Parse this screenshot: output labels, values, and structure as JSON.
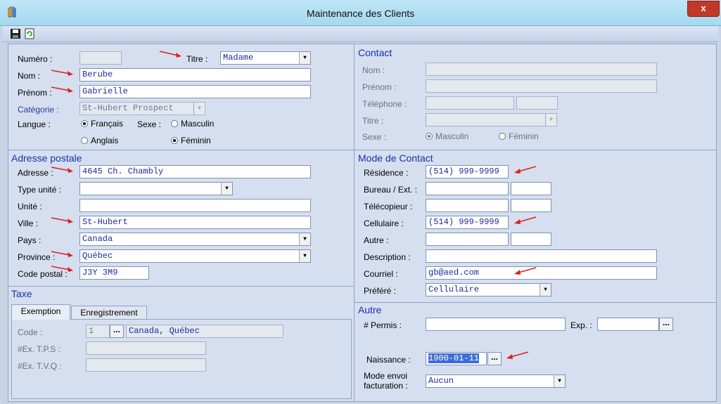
{
  "window": {
    "title": "Maintenance des Clients",
    "close_label": "x"
  },
  "toolbar": {
    "save_icon": "save-icon",
    "refresh_icon": "refresh-icon"
  },
  "client": {
    "numero_label": "Numéro :",
    "numero_value": "",
    "titre_label": "Titre :",
    "titre_value": "Madame",
    "nom_label": "Nom :",
    "nom_value": "Berube",
    "prenom_label": "Prénom :",
    "prenom_value": "Gabrielle",
    "categorie_label": "Catégorie :",
    "categorie_value": "St-Hubert Prospect",
    "langue_label": "Langue :",
    "langue_fr": "Français",
    "langue_en": "Anglais",
    "sexe_label": "Sexe :",
    "sexe_m": "Masculin",
    "sexe_f": "Féminin"
  },
  "contact": {
    "title": "Contact",
    "nom_label": "Nom :",
    "prenom_label": "Prénom :",
    "telephone_label": "Téléphone :",
    "titre_label": "Titre :",
    "sexe_label": "Sexe :",
    "sexe_m": "Masculin",
    "sexe_f": "Féminin"
  },
  "adresse": {
    "title": "Adresse postale",
    "adresse_label": "Adresse :",
    "adresse_value": "4645 Ch. Chambly",
    "type_unite_label": "Type unité :",
    "type_unite_value": "",
    "unite_label": "Unité :",
    "unite_value": "",
    "ville_label": "Ville :",
    "ville_value": "St-Hubert",
    "pays_label": "Pays :",
    "pays_value": "Canada",
    "province_label": "Province :",
    "province_value": "Québec",
    "code_postal_label": "Code postal :",
    "code_postal_value": "J3Y 3M9"
  },
  "mode_contact": {
    "title": "Mode de Contact",
    "residence_label": "Résidence :",
    "residence_value": "(514) 999-9999",
    "bureau_label": "Bureau / Ext. :",
    "telecopieur_label": "Télécopieur :",
    "cellulaire_label": "Cellulaire :",
    "cellulaire_value": "(514) 999-9999",
    "autre_label": "Autre :",
    "description_label": "Description :",
    "courriel_label": "Courriel :",
    "courriel_value": "gb@aed.com",
    "prefere_label": "Préféré :",
    "prefere_value": "Cellulaire"
  },
  "taxe": {
    "title": "Taxe",
    "tabs": [
      "Exemption",
      "Enregistrement"
    ],
    "code_label": "Code :",
    "code_value": "1",
    "code_desc": "Canada, Québec",
    "tps_label": "#Ex. T.P.S :",
    "tvq_label": "#Ex. T.V.Q :"
  },
  "autre": {
    "title": "Autre",
    "permis_label": "# Permis :",
    "exp_label": "Exp. :",
    "naissance_label": "Naissance :",
    "naissance_value": "1900-01-11",
    "mode_envoi_label_1": "Mode envoi",
    "mode_envoi_label_2": "facturation :",
    "mode_envoi_value": "Aucun"
  },
  "buttons": {
    "dots": "..."
  },
  "colors": {
    "accent": "#1b2fa8",
    "field_text": "#1a2b9a",
    "arrow": "#e02020",
    "close": "#c0392b"
  }
}
